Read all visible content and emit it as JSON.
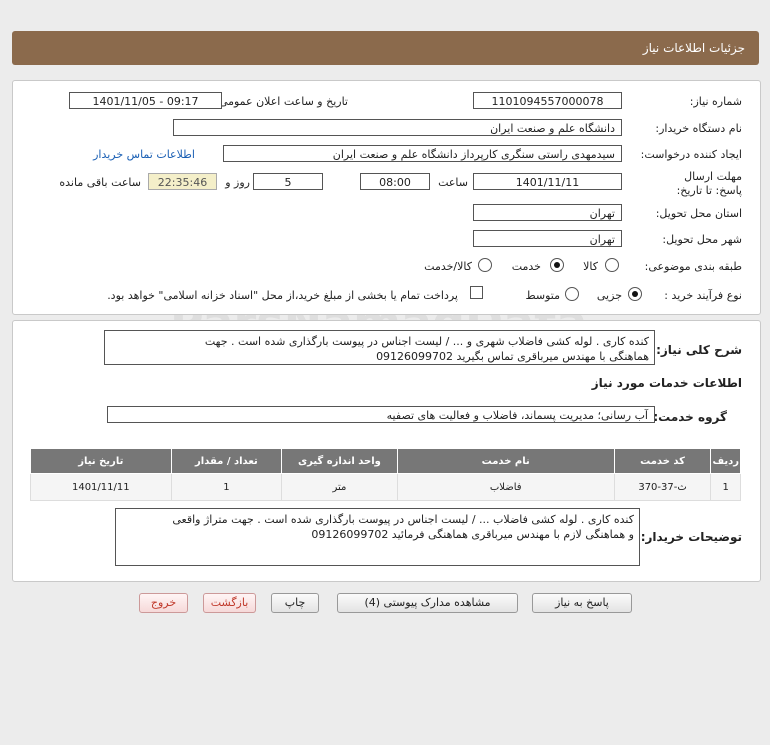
{
  "header": {
    "title": "جزئیات اطلاعات نیاز"
  },
  "form": {
    "need_number_label": "شماره نیاز:",
    "need_number": "1101094557000078",
    "announce_label": "تاریخ و ساعت اعلان عمومی:",
    "announce_value": "1401/11/05 - 09:17",
    "buyer_org_label": "نام دستگاه خریدار:",
    "buyer_org": "دانشگاه علم و صنعت ایران",
    "requester_label": "ایجاد کننده درخواست:",
    "requester": "سیدمهدی راستی سنگری کارپرداز دانشگاه علم و صنعت ایران",
    "contact_link": "اطلاعات تماس خریدار",
    "deadline_label": "مهلت ارسال پاسخ: تا تاریخ:",
    "deadline_date": "1401/11/11",
    "time_label": "ساعت",
    "deadline_time": "08:00",
    "days_value": "5",
    "days_label": "روز و",
    "remaining_time": "22:35:46",
    "remaining_label": "ساعت باقی مانده",
    "province_label": "استان محل تحویل:",
    "province": "تهران",
    "city_label": "شهر محل تحویل:",
    "city": "تهران",
    "category_label": "طبقه بندی موضوعی:",
    "category_options": [
      "کالا",
      "خدمت",
      "کالا/خدمت"
    ],
    "category_selected": "خدمت",
    "process_label": "نوع فرآیند خرید :",
    "process_options": [
      "جزیی",
      "متوسط"
    ],
    "process_selected": "جزیی",
    "payment_note": "پرداخت تمام یا بخشی از مبلغ خرید،از محل \"اسناد خزانه اسلامی\" خواهد بود."
  },
  "summary": {
    "label": "شرح کلی نیاز:",
    "text_line1": "کنده کاری . لوله کشی فاضلاب  شهری و ... / لیست اجناس در پیوست بارگذاری شده است . جهت",
    "text_line2": "هماهنگی با مهندس میرباقری تماس بگیرید 09126099702"
  },
  "services": {
    "section_title": "اطلاعات خدمات مورد نیاز",
    "group_label": "گروه خدمت:",
    "group_value": "آب رسانی؛ مدیریت پسماند، فاضلاب و فعالیت های تصفیه",
    "table": {
      "headers": [
        "ردیف",
        "کد خدمت",
        "نام خدمت",
        "واحد اندازه گیری",
        "تعداد / مقدار",
        "تاریخ نیاز"
      ],
      "rows": [
        [
          "1",
          "ث-37-370",
          "فاضلاب",
          "متر",
          "1",
          "1401/11/11"
        ]
      ]
    }
  },
  "buyer_notes": {
    "label": "توضیحات خریدار:",
    "text_line1": "کنده کاری . لوله کشی فاضلاب  ... / لیست اجناس در پیوست بارگذاری شده است . جهت  متراژ واقعی",
    "text_line2": "و هماهنگی لازم  با مهندس میرباقری هماهنگی فرمائید 09126099702"
  },
  "buttons": {
    "reply": "پاسخ به نیاز",
    "attachments": "مشاهده مدارک پیوستی (4)",
    "print": "چاپ",
    "back": "بازگشت",
    "exit": "خروج"
  },
  "watermark": {
    "brand": "ParsNamadData",
    "line1": "مرکز فراوری اطلاعات پارس نماد داده",
    "line2": "پایگاه اطلاع رسانی مناقصه و مزایده"
  },
  "colors": {
    "title_bar": "#8b6a4c",
    "remaining_bg": "#f4efc9",
    "table_header": "#777777"
  }
}
